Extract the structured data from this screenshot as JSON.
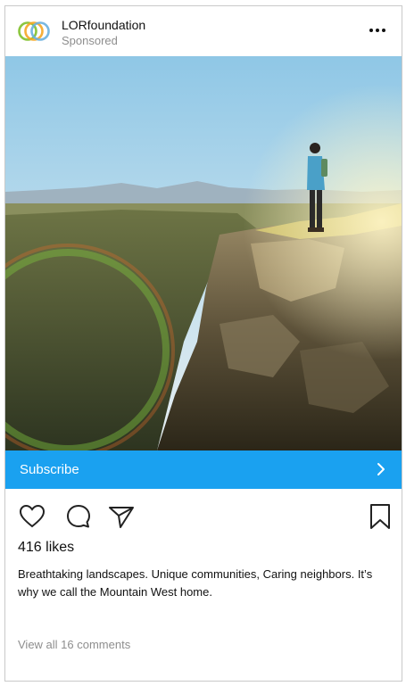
{
  "post": {
    "brand_name": "LORfoundation",
    "sponsored_label": "Sponsored",
    "more_icon": "more-horizontal-icon",
    "photo_description_icon": "hiker-on-cliff-photo",
    "cta_label": "Subscribe",
    "cta_color": "#1aa1f0",
    "likes_text": "416 likes",
    "caption": "Breathtaking landscapes. Unique communities, Caring neighbors. It’s why we call the Mountain West home.",
    "comments_link": "View all 16 comments"
  }
}
